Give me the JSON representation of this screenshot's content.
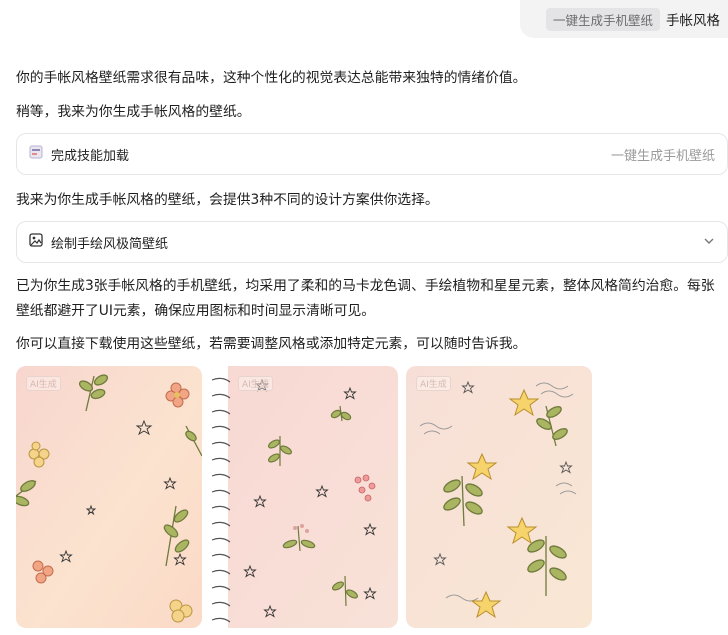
{
  "user_message": {
    "skill_tag": "一键生成手机壁纸",
    "text": "手帐风格"
  },
  "assistant": {
    "intro": "你的手帐风格壁纸需求很有品味，这种个性化的视觉表达总能带来独特的情绪价值。",
    "wait": "稍等，我来为你生成手帐风格的壁纸。",
    "skill_card": {
      "icon": "skill-load-icon",
      "label": "完成技能加载",
      "skill_name": "一键生成手机壁纸"
    },
    "plan": "我来为你生成手帐风格的壁纸，会提供3种不同的设计方案供你选择。",
    "tool_card": {
      "icon": "image-icon",
      "label": "绘制手绘风极简壁纸",
      "chevron": "chevron-down-icon"
    },
    "result": "已为你生成3张手帐风格的手机壁纸，均采用了柔和的马卡龙色调、手绘植物和星星元素，整体风格简约治愈。每张壁纸都避开了UI元素，确保应用图标和时间显示清晰可见。",
    "closing": "你可以直接下载使用这些壁纸，若需要调整风格或添加特定元素，可以随时告诉我。",
    "images": [
      {
        "name": "wallpaper-floral",
        "badge": "AI生成"
      },
      {
        "name": "wallpaper-notebook",
        "badge": "AI生成"
      },
      {
        "name": "wallpaper-stars",
        "badge": "AI生成"
      }
    ]
  }
}
